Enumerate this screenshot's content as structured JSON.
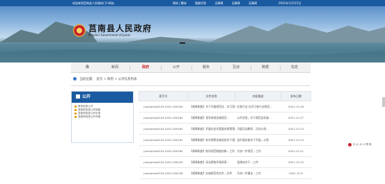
{
  "topbar": {
    "welcome": "欢迎来到莒南县人民政府门户网站",
    "links": [
      "简体 | 繁体",
      "智能问答",
      "无障碍",
      "无障碍",
      "无障碍"
    ],
    "date": "2021年12月15日"
  },
  "site": {
    "name": "莒南县人民政府",
    "name_en": "People's Government of Junan"
  },
  "nav": {
    "items": [
      "首页",
      "新闻",
      "政府",
      "公开",
      "服务",
      "互动",
      "数据",
      "信息"
    ],
    "active_index": 2
  },
  "breadcrumb": {
    "prefix": "当前位置：",
    "path": [
      "首页",
      "政府",
      "公开信息列表"
    ],
    "separator": " > "
  },
  "side": {
    "title": "公开",
    "items": [
      "政务信息公开",
      "县政府信息公开指南",
      "县政府信息公开目录",
      "县政府信息公开年报"
    ]
  },
  "table": {
    "headers": [
      "索引号",
      "文件名称",
      "内容描述",
      "发布日期"
    ],
    "rows": [
      [
        "junanjmxs0104-2021-000164",
        "【规章制度】关于开展规范化…学习宣传…",
        "在各行业 在学习各行业规范…",
        "2021-12-28"
      ],
      [
        "junanjmxs0104-2021-000163",
        "【规章制度】领导有效实施规范…",
        "公开信息，关于规范自实施…",
        "2021-12-27"
      ],
      [
        "junanjmxs0104-2021-000162",
        "【规章制度】开展社会关爱服务政策落实…",
        "开展活动期间…活动计划…",
        "2021-12-23"
      ],
      [
        "junanjmxs0104-2021-000161",
        "【规章制度】有关政策实施进程关于落实…",
        "县开展实施关于开展…计划",
        "2021-12-23"
      ],
      [
        "junanjmxs0104-2021-000160",
        "【规章制度】依托规范制度创新…工作",
        "为进一步规范…工作",
        "2021-12-21"
      ],
      [
        "junanjmxs0104-2021-000159",
        "【规章制度】深化营商环境改革…",
        "县政府关于…工作",
        "2021-12-15"
      ],
      [
        "junanjmxs0104-2021-000158",
        "【规章制度】实施规范性文件…文件",
        "为进一步健全…工作",
        "2021-12-9"
      ]
    ]
  },
  "widget": {
    "labels": [
      "中",
      "心",
      "大",
      "小",
      "帮",
      "助"
    ]
  },
  "colors": {
    "primary": "#1a5aa0",
    "accent": "#c8222a"
  }
}
